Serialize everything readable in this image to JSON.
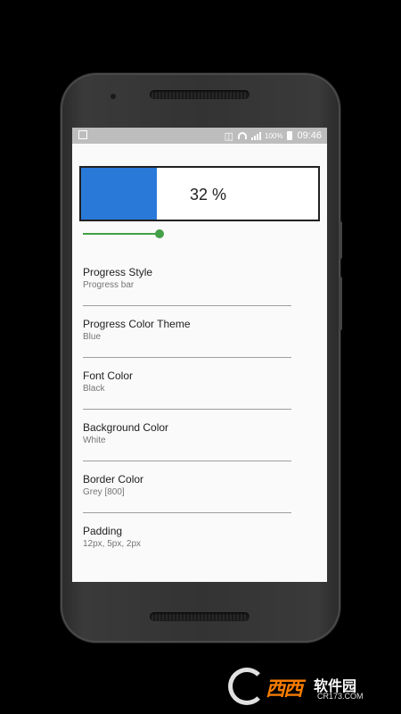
{
  "status_bar": {
    "battery_percent": "100%",
    "time": "09:46"
  },
  "progress": {
    "value_percent": 32,
    "label": "32 %",
    "fill_color": "#2979d9",
    "border_color": "#212121"
  },
  "slider": {
    "value_fraction": 1.0,
    "color": "#43a047"
  },
  "settings": [
    {
      "title": "Progress Style",
      "value": "Progress bar"
    },
    {
      "title": "Progress Color Theme",
      "value": "Blue"
    },
    {
      "title": "Font Color",
      "value": "Black"
    },
    {
      "title": "Background Color",
      "value": "White"
    },
    {
      "title": "Border Color",
      "value": "Grey [800]"
    },
    {
      "title": "Padding",
      "value": "12px, 5px, 2px"
    }
  ],
  "watermark": {
    "brand": "西西",
    "text": "软件园",
    "domain": "CR173.COM"
  }
}
